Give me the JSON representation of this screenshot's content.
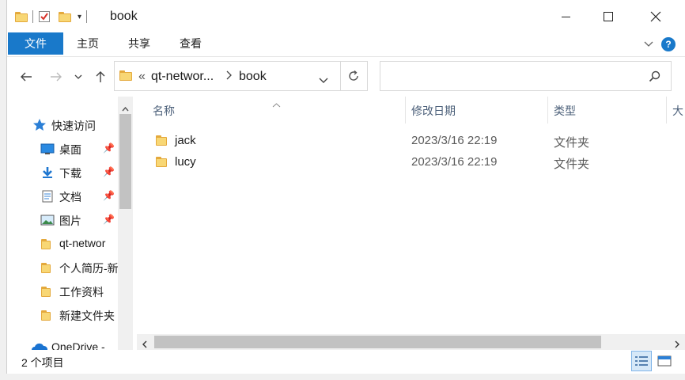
{
  "window": {
    "title": "book"
  },
  "ribbon": {
    "tabs": [
      {
        "label": "文件"
      },
      {
        "label": "主页"
      },
      {
        "label": "共享"
      },
      {
        "label": "查看"
      }
    ]
  },
  "address": {
    "overflow": "«",
    "crumbs": [
      "qt-networ...",
      "book"
    ]
  },
  "search": {
    "placeholder": ""
  },
  "nav": {
    "items": [
      {
        "label": "快速访问",
        "icon": "star-icon",
        "pinned": false
      },
      {
        "label": "桌面",
        "icon": "desktop-icon",
        "pinned": true
      },
      {
        "label": "下载",
        "icon": "download-icon",
        "pinned": true
      },
      {
        "label": "文档",
        "icon": "document-icon",
        "pinned": true
      },
      {
        "label": "图片",
        "icon": "pictures-icon",
        "pinned": true
      },
      {
        "label": "qt-networ",
        "icon": "folder-icon",
        "pinned": false
      },
      {
        "label": "个人简历-新",
        "icon": "folder-icon",
        "pinned": false
      },
      {
        "label": "工作资料",
        "icon": "folder-icon",
        "pinned": false
      },
      {
        "label": "新建文件夹",
        "icon": "folder-icon",
        "pinned": false
      },
      {
        "label": "OneDrive -",
        "icon": "onedrive-icon",
        "pinned": false
      }
    ]
  },
  "table": {
    "columns": [
      "名称",
      "修改日期",
      "类型",
      "大"
    ],
    "rows": [
      {
        "name": "jack",
        "date": "2023/3/16 22:19",
        "type": "文件夹"
      },
      {
        "name": "lucy",
        "date": "2023/3/16 22:19",
        "type": "文件夹"
      }
    ]
  },
  "status": {
    "count": "2 个项目"
  },
  "colors": {
    "accent": "#1979ca",
    "folder": "#f8d775",
    "folder_edge": "#e4a93c"
  }
}
